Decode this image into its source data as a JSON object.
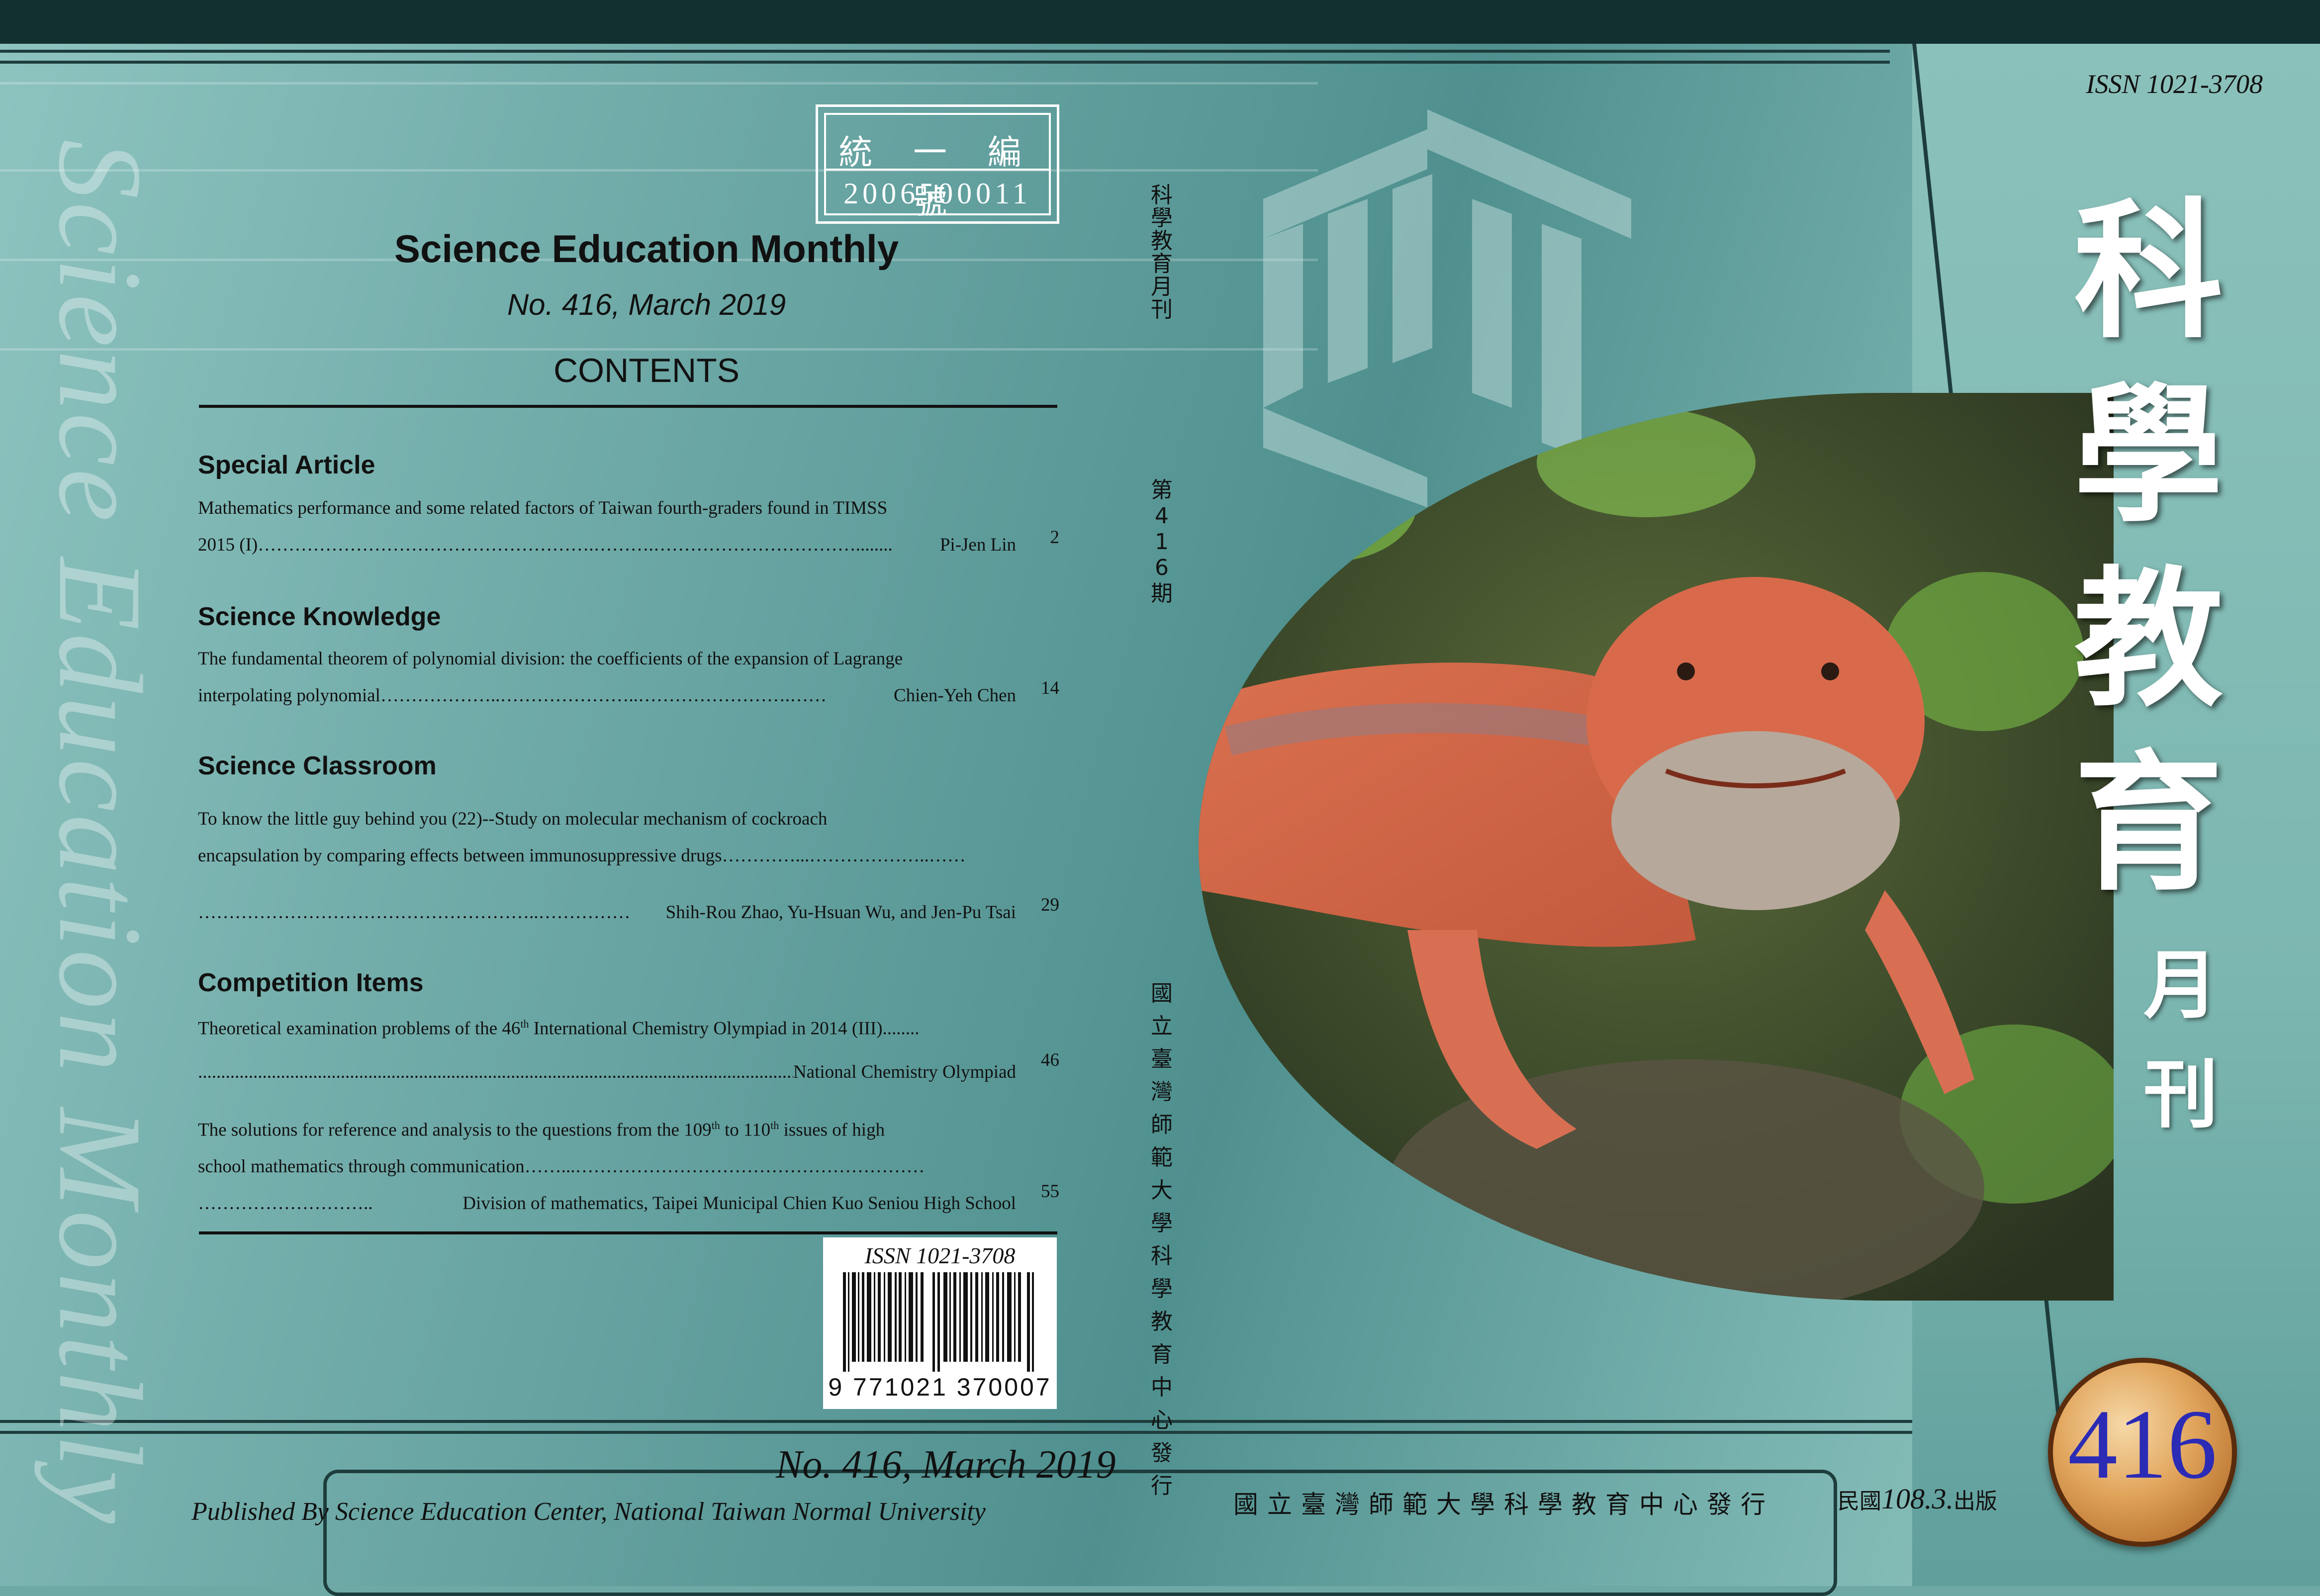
{
  "cover": {
    "serial_label": "統 一 編 號",
    "serial_number": "2006500011",
    "journal_title": "Science Education Monthly",
    "issue_line": "No. 416, March 2019",
    "contents_heading": "CONTENTS",
    "spine_title": "Science Education Monthly"
  },
  "sections": [
    {
      "heading": "Special Article",
      "entries": [
        {
          "line1": "Mathematics performance and some related factors of Taiwan fourth-graders found in TIMSS",
          "line2_start": "2015 (I)",
          "line2_end": "Pi-Jen Lin",
          "page": "2"
        }
      ]
    },
    {
      "heading": "Science Knowledge",
      "entries": [
        {
          "line1": "The fundamental theorem of polynomial division: the coefficients of the expansion of Lagrange",
          "line2_start": "interpolating polynomial",
          "line2_end": "Chien-Yeh Chen",
          "page": "14"
        }
      ]
    },
    {
      "heading": "Science Classroom",
      "entries": [
        {
          "line1": "To know the little guy behind you (22)--Study on molecular mechanism of cockroach",
          "line2_start": "encapsulation by comparing effects between immunosuppressive drugs",
          "line3_end": "Shih-Rou Zhao, Yu-Hsuan Wu, and Jen-Pu Tsai",
          "page": "29"
        }
      ]
    },
    {
      "heading": "Competition Items",
      "entries": [
        {
          "line1_a": "Theoretical examination problems of the 46",
          "line1_sup": "th",
          "line1_b": " International Chemistry Olympiad in 2014 (III)",
          "line2_end": "National Chemistry Olympiad",
          "page": "46"
        },
        {
          "line1_a": "The solutions for reference and analysis to the questions from the 109",
          "line1_sup1": "th",
          "line1_b": " to 110",
          "line1_sup2": "th",
          "line1_c": " issues of high",
          "line2_start": "school mathematics through communication",
          "line3_end": "Division of mathematics, Taipei Municipal Chien Kuo Seniou High School",
          "page": "55"
        }
      ]
    }
  ],
  "barcode": {
    "issn": "ISSN 1021-3708",
    "digits": "9 771021 370007"
  },
  "spine": {
    "name": "科學教育月刊",
    "issue_no": "第416期",
    "publisher": "國立臺灣師範大學科學教育中心發行"
  },
  "front": {
    "issn": "ISSN 1021-3708",
    "title": "科學教育",
    "monthly_1": "月",
    "monthly_2": "刊",
    "issue_badge": "416",
    "publisher_cn": "國立臺灣師範大學科學教育中心發行",
    "date_prefix": "民國",
    "date_value": "108.3.",
    "date_suffix": "出版"
  },
  "back_bottom": {
    "issue_line": "No. 416, March 2019",
    "published_by": "Published By Science Education Center, National Taiwan Normal University"
  },
  "colors": {
    "background": "#6fa9a6",
    "dark_frame": "#1d3d3c",
    "badge_number": "#2b2bb5"
  }
}
